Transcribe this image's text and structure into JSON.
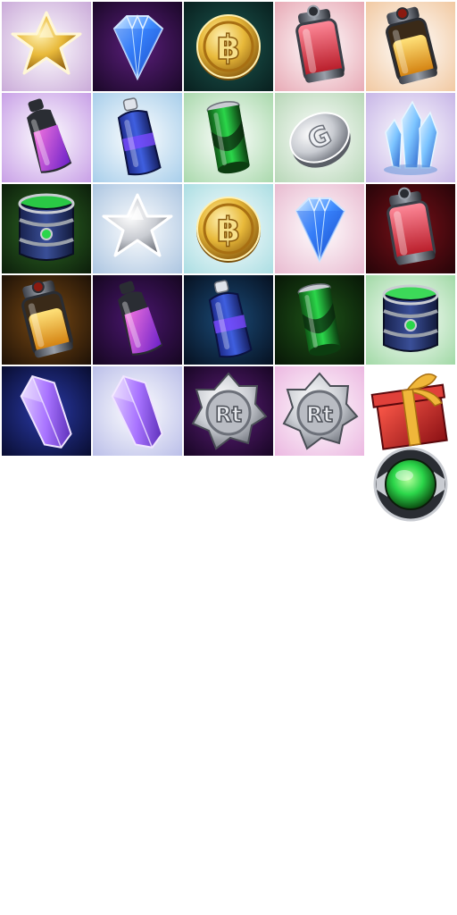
{
  "sprite_sheet": {
    "glyphs": {
      "bitcoin": "฿",
      "coin_g": "G",
      "token": "Rt"
    },
    "colors": {
      "gold": "#e8b93a",
      "sapphire": "#3f8cff",
      "crystal": "#7cc4ff",
      "amethyst": "#a873ff",
      "energy_green": "#2bd64a",
      "fuel_red": "#e5323a",
      "fuel_yellow": "#f5b21c",
      "silver": "#c9ccd2",
      "gift_red": "#c8282a",
      "ribbon_gold": "#f0b73a"
    },
    "items": [
      {
        "icon": "gold-star-icon",
        "bg": [
          "#ffffff",
          "#c9a9d8"
        ]
      },
      {
        "icon": "sapphire-gem-icon",
        "bg": [
          "#5b1f7c",
          "#190726"
        ]
      },
      {
        "icon": "bitcoin-coin-icon",
        "bg": [
          "#1d5a52",
          "#081e1d"
        ]
      },
      {
        "icon": "red-fuel-canister-icon",
        "bg": [
          "#ffffff",
          "#e7a8b4"
        ]
      },
      {
        "icon": "yellow-fuel-canister-icon",
        "bg": [
          "#ffffff",
          "#f1c8a0"
        ]
      },
      {
        "icon": "purple-energy-bottle-icon",
        "bg": [
          "#ffffff",
          "#c79ee6"
        ]
      },
      {
        "icon": "blue-energy-bottle-icon",
        "bg": [
          "#ffffff",
          "#a6cdea"
        ]
      },
      {
        "icon": "green-energy-can-icon",
        "bg": [
          "#ffffff",
          "#a8d8ab"
        ]
      },
      {
        "icon": "silver-g-coin-icon",
        "bg": [
          "#ffffff",
          "#b6d6b6"
        ]
      },
      {
        "icon": "blue-crystal-cluster-icon",
        "bg": [
          "#ffffff",
          "#c6b4e6"
        ]
      },
      {
        "icon": "green-barrel-icon",
        "bg": [
          "#2f6a25",
          "#0b1c0a"
        ]
      },
      {
        "icon": "silver-star-icon",
        "bg": [
          "#ffffff",
          "#aac4e0"
        ]
      },
      {
        "icon": "bitcoin-coin-icon",
        "bg": [
          "#ffffff",
          "#a9dde2"
        ]
      },
      {
        "icon": "sapphire-gem-icon",
        "bg": [
          "#ffffff",
          "#e8b9cf"
        ]
      },
      {
        "icon": "red-fuel-canister-icon",
        "bg": [
          "#7a1018",
          "#240408"
        ]
      },
      {
        "icon": "yellow-fuel-canister-icon",
        "bg": [
          "#7a4a14",
          "#1c1006"
        ]
      },
      {
        "icon": "purple-energy-bottle-icon",
        "bg": [
          "#4b1770",
          "#14061e"
        ]
      },
      {
        "icon": "blue-energy-bottle-icon",
        "bg": [
          "#1b4b78",
          "#050f1e"
        ]
      },
      {
        "icon": "green-energy-can-icon",
        "bg": [
          "#1e5418",
          "#071506"
        ]
      },
      {
        "icon": "green-barrel-icon",
        "bg": [
          "#ffffff",
          "#9fd8a4"
        ]
      },
      {
        "icon": "purple-crystal-icon",
        "bg": [
          "#2a3aa8",
          "#080c2e"
        ]
      },
      {
        "icon": "purple-crystal-icon",
        "bg": [
          "#ffffff",
          "#b9bde8"
        ]
      },
      {
        "icon": "rt-token-icon",
        "bg": [
          "#5d1f79",
          "#160522"
        ]
      },
      {
        "icon": "rt-token-icon",
        "bg": [
          "#ffffff",
          "#ebb6e0"
        ]
      },
      {
        "icon": "gift-box-icon",
        "bg": null
      },
      {
        "icon": "green-orb-button-icon",
        "bg": null
      }
    ]
  }
}
